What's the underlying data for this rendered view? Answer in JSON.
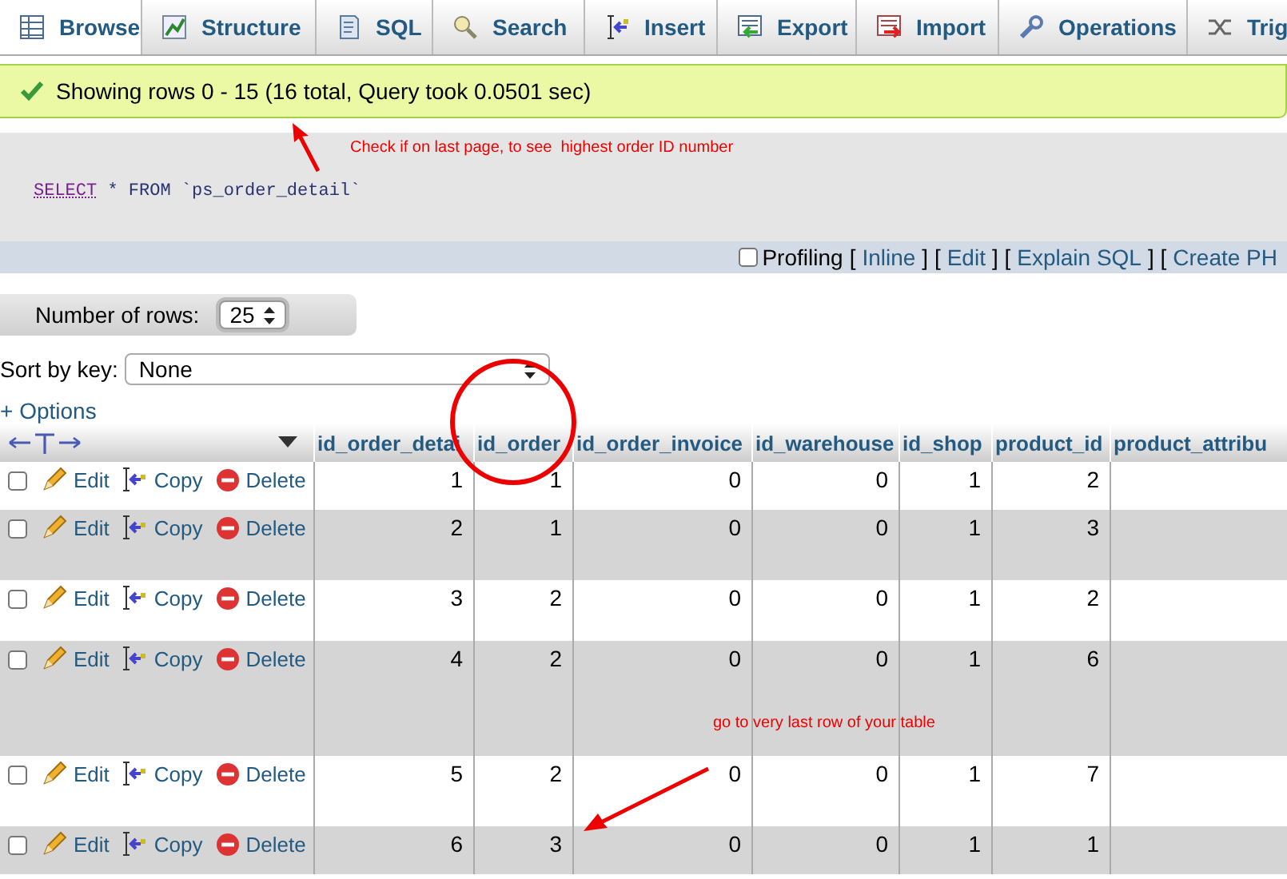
{
  "tabs": [
    {
      "label": "Browse",
      "selected": true
    },
    {
      "label": "Structure",
      "selected": false
    },
    {
      "label": "SQL",
      "selected": false
    },
    {
      "label": "Search",
      "selected": false
    },
    {
      "label": "Insert",
      "selected": false
    },
    {
      "label": "Export",
      "selected": false
    },
    {
      "label": "Import",
      "selected": false
    },
    {
      "label": "Operations",
      "selected": false
    },
    {
      "label": "Trig",
      "selected": false
    }
  ],
  "message": "Showing rows 0 - 15 (16 total, Query took 0.0501 sec)",
  "query": {
    "keyword": "SELECT",
    "rest": "* FROM `ps_order_detail`"
  },
  "profiling": {
    "checked": false,
    "label": "Profiling",
    "items": [
      {
        "kind": "punct",
        "text": "["
      },
      {
        "kind": "link",
        "text": "Inline"
      },
      {
        "kind": "punct",
        "text": "] ["
      },
      {
        "kind": "link",
        "text": "Edit"
      },
      {
        "kind": "punct",
        "text": "] ["
      },
      {
        "kind": "link",
        "text": "Explain SQL"
      },
      {
        "kind": "punct",
        "text": "] ["
      },
      {
        "kind": "link",
        "text": "Create PH"
      }
    ]
  },
  "rows_control": {
    "label": "Number of rows:",
    "value": "25"
  },
  "sort": {
    "label": "Sort by key:",
    "value": "None"
  },
  "options": "+ Options",
  "table": {
    "columns": [
      "id_order_detai",
      "id_order",
      "id_order_invoice",
      "id_warehouse",
      "id_shop",
      "product_id",
      "product_attribu"
    ],
    "rows": [
      {
        "checked": false,
        "actions": [
          "Edit",
          "Copy",
          "Delete"
        ],
        "cells": [
          "1",
          "1",
          "0",
          "0",
          "1",
          "2"
        ]
      },
      {
        "checked": false,
        "actions": [
          "Edit",
          "Copy",
          "Delete"
        ],
        "cells": [
          "2",
          "1",
          "0",
          "0",
          "1",
          "3"
        ]
      },
      {
        "checked": false,
        "actions": [
          "Edit",
          "Copy",
          "Delete"
        ],
        "cells": [
          "3",
          "2",
          "0",
          "0",
          "1",
          "2"
        ]
      },
      {
        "checked": false,
        "actions": [
          "Edit",
          "Copy",
          "Delete"
        ],
        "cells": [
          "4",
          "2",
          "0",
          "0",
          "1",
          "6"
        ]
      },
      {
        "checked": false,
        "actions": [
          "Edit",
          "Copy",
          "Delete"
        ],
        "cells": [
          "5",
          "2",
          "0",
          "0",
          "1",
          "7"
        ]
      },
      {
        "checked": false,
        "actions": [
          "Edit",
          "Copy",
          "Delete"
        ],
        "cells": [
          "6",
          "3",
          "0",
          "0",
          "1",
          "1"
        ]
      }
    ]
  },
  "annotations": [
    {
      "text": "Check if on last page, to see  highest order ID number"
    },
    {
      "text": "go to very last row of your table"
    }
  ]
}
